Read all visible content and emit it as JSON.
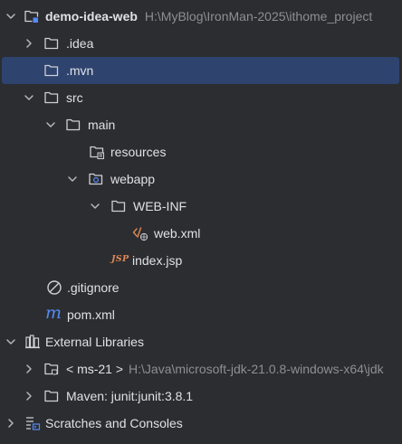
{
  "tree": {
    "root": {
      "name": "demo-idea-web",
      "path": "H:\\MyBlog\\IronMan-2025\\ithome_project"
    },
    "idea": {
      "name": ".idea"
    },
    "mvn": {
      "name": ".mvn"
    },
    "src": {
      "name": "src"
    },
    "main": {
      "name": "main"
    },
    "resources": {
      "name": "resources"
    },
    "webapp": {
      "name": "webapp"
    },
    "webinf": {
      "name": "WEB-INF"
    },
    "webxml": {
      "name": "web.xml"
    },
    "indexjsp": {
      "name": "index.jsp"
    },
    "gitignore": {
      "name": ".gitignore"
    },
    "pomxml": {
      "name": "pom.xml"
    },
    "external": {
      "name": "External Libraries"
    },
    "jdk": {
      "name": "< ms-21 >",
      "path": "H:\\Java\\microsoft-jdk-21.0.8-windows-x64\\jdk"
    },
    "maven": {
      "name": "Maven: junit:junit:3.8.1"
    },
    "scratches": {
      "name": "Scratches and Consoles"
    }
  },
  "colors": {
    "background": "#2b2d30",
    "selection": "#2e436e",
    "text": "#dfe1e5",
    "secondary": "#8c8f94",
    "maven_accent": "#548af7",
    "jsp_accent": "#e08855"
  }
}
